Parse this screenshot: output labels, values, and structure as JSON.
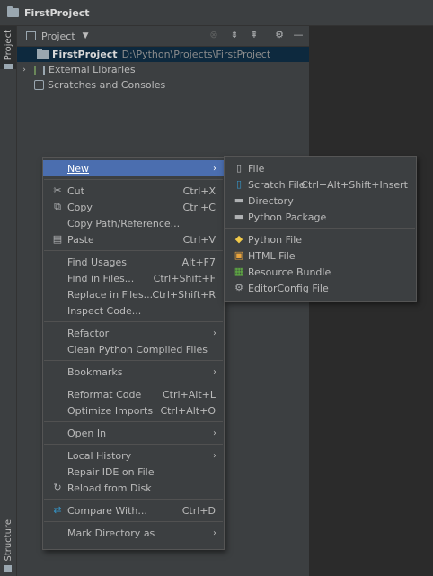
{
  "window": {
    "title": "FirstProject"
  },
  "left_tabs": {
    "project": "Project",
    "structure": "Structure"
  },
  "project_panel": {
    "view_selector": "Project",
    "tree": [
      {
        "label": "FirstProject",
        "path": "D:\\Python\\Projects\\FirstProject"
      },
      {
        "label": "External Libraries"
      },
      {
        "label": "Scratches and Consoles"
      }
    ]
  },
  "context_menu": {
    "new": "New",
    "cut": "Cut",
    "cut_sc": "Ctrl+X",
    "copy": "Copy",
    "copy_sc": "Ctrl+C",
    "copy_path": "Copy Path/Reference...",
    "paste": "Paste",
    "paste_sc": "Ctrl+V",
    "find_usages": "Find Usages",
    "find_usages_sc": "Alt+F7",
    "find_in_files": "Find in Files...",
    "find_in_files_sc": "Ctrl+Shift+F",
    "replace_in_files": "Replace in Files...",
    "replace_in_files_sc": "Ctrl+Shift+R",
    "inspect_code": "Inspect Code...",
    "refactor": "Refactor",
    "clean_compiled": "Clean Python Compiled Files",
    "bookmarks": "Bookmarks",
    "reformat_code": "Reformat Code",
    "reformat_code_sc": "Ctrl+Alt+L",
    "optimize_imports": "Optimize Imports",
    "optimize_imports_sc": "Ctrl+Alt+O",
    "open_in": "Open In",
    "local_history": "Local History",
    "repair_ide": "Repair IDE on File",
    "reload_disk": "Reload from Disk",
    "compare_with": "Compare With...",
    "compare_with_sc": "Ctrl+D",
    "mark_directory": "Mark Directory as"
  },
  "new_submenu": {
    "file": "File",
    "scratch_file": "Scratch File",
    "scratch_file_sc": "Ctrl+Alt+Shift+Insert",
    "directory": "Directory",
    "python_package": "Python Package",
    "python_file": "Python File",
    "html_file": "HTML File",
    "resource_bundle": "Resource Bundle",
    "editorconfig_file": "EditorConfig File"
  }
}
